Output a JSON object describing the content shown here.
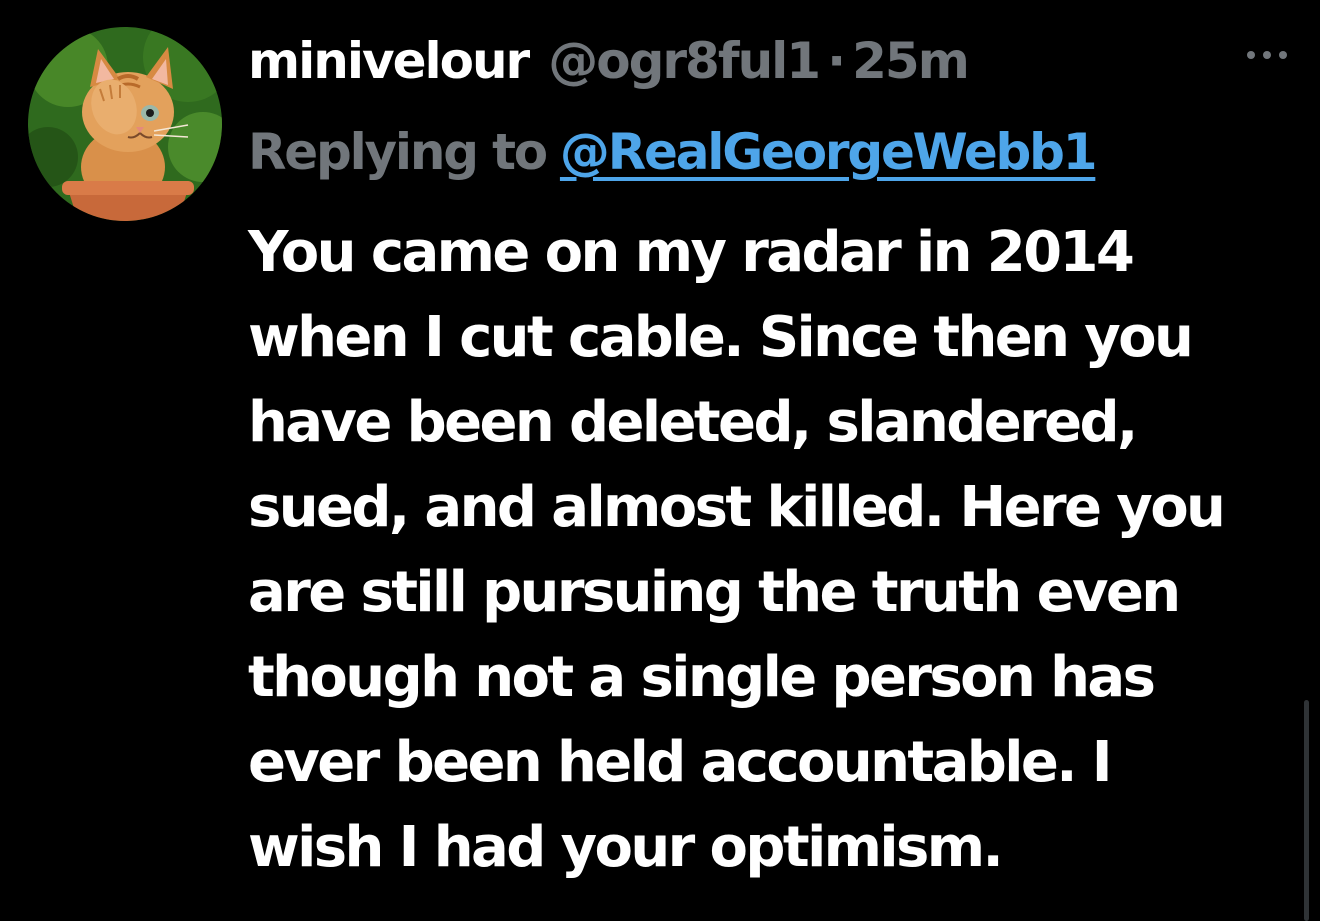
{
  "tweet": {
    "avatar_icon": "kitten-avatar",
    "display_name": "minivelour",
    "handle": "@ogr8ful1",
    "separator": "·",
    "time": "25m",
    "more_icon": "more-horizontal-icon",
    "reply_prefix": "Replying to",
    "reply_handle": "@RealGeorgeWebb1",
    "text_lines": [
      "You came on my radar in 2014",
      "when I cut cable. Since then you",
      "have been deleted, slandered,",
      "sued, and almost killed. Here you",
      "are still pursuing the truth even",
      "though not a single person has",
      "ever been held accountable. I",
      "wish I had your optimism."
    ]
  },
  "colors": {
    "background": "#000000",
    "primary_text": "#ffffff",
    "secondary_text": "#71767b",
    "link": "#4ea5e9"
  }
}
